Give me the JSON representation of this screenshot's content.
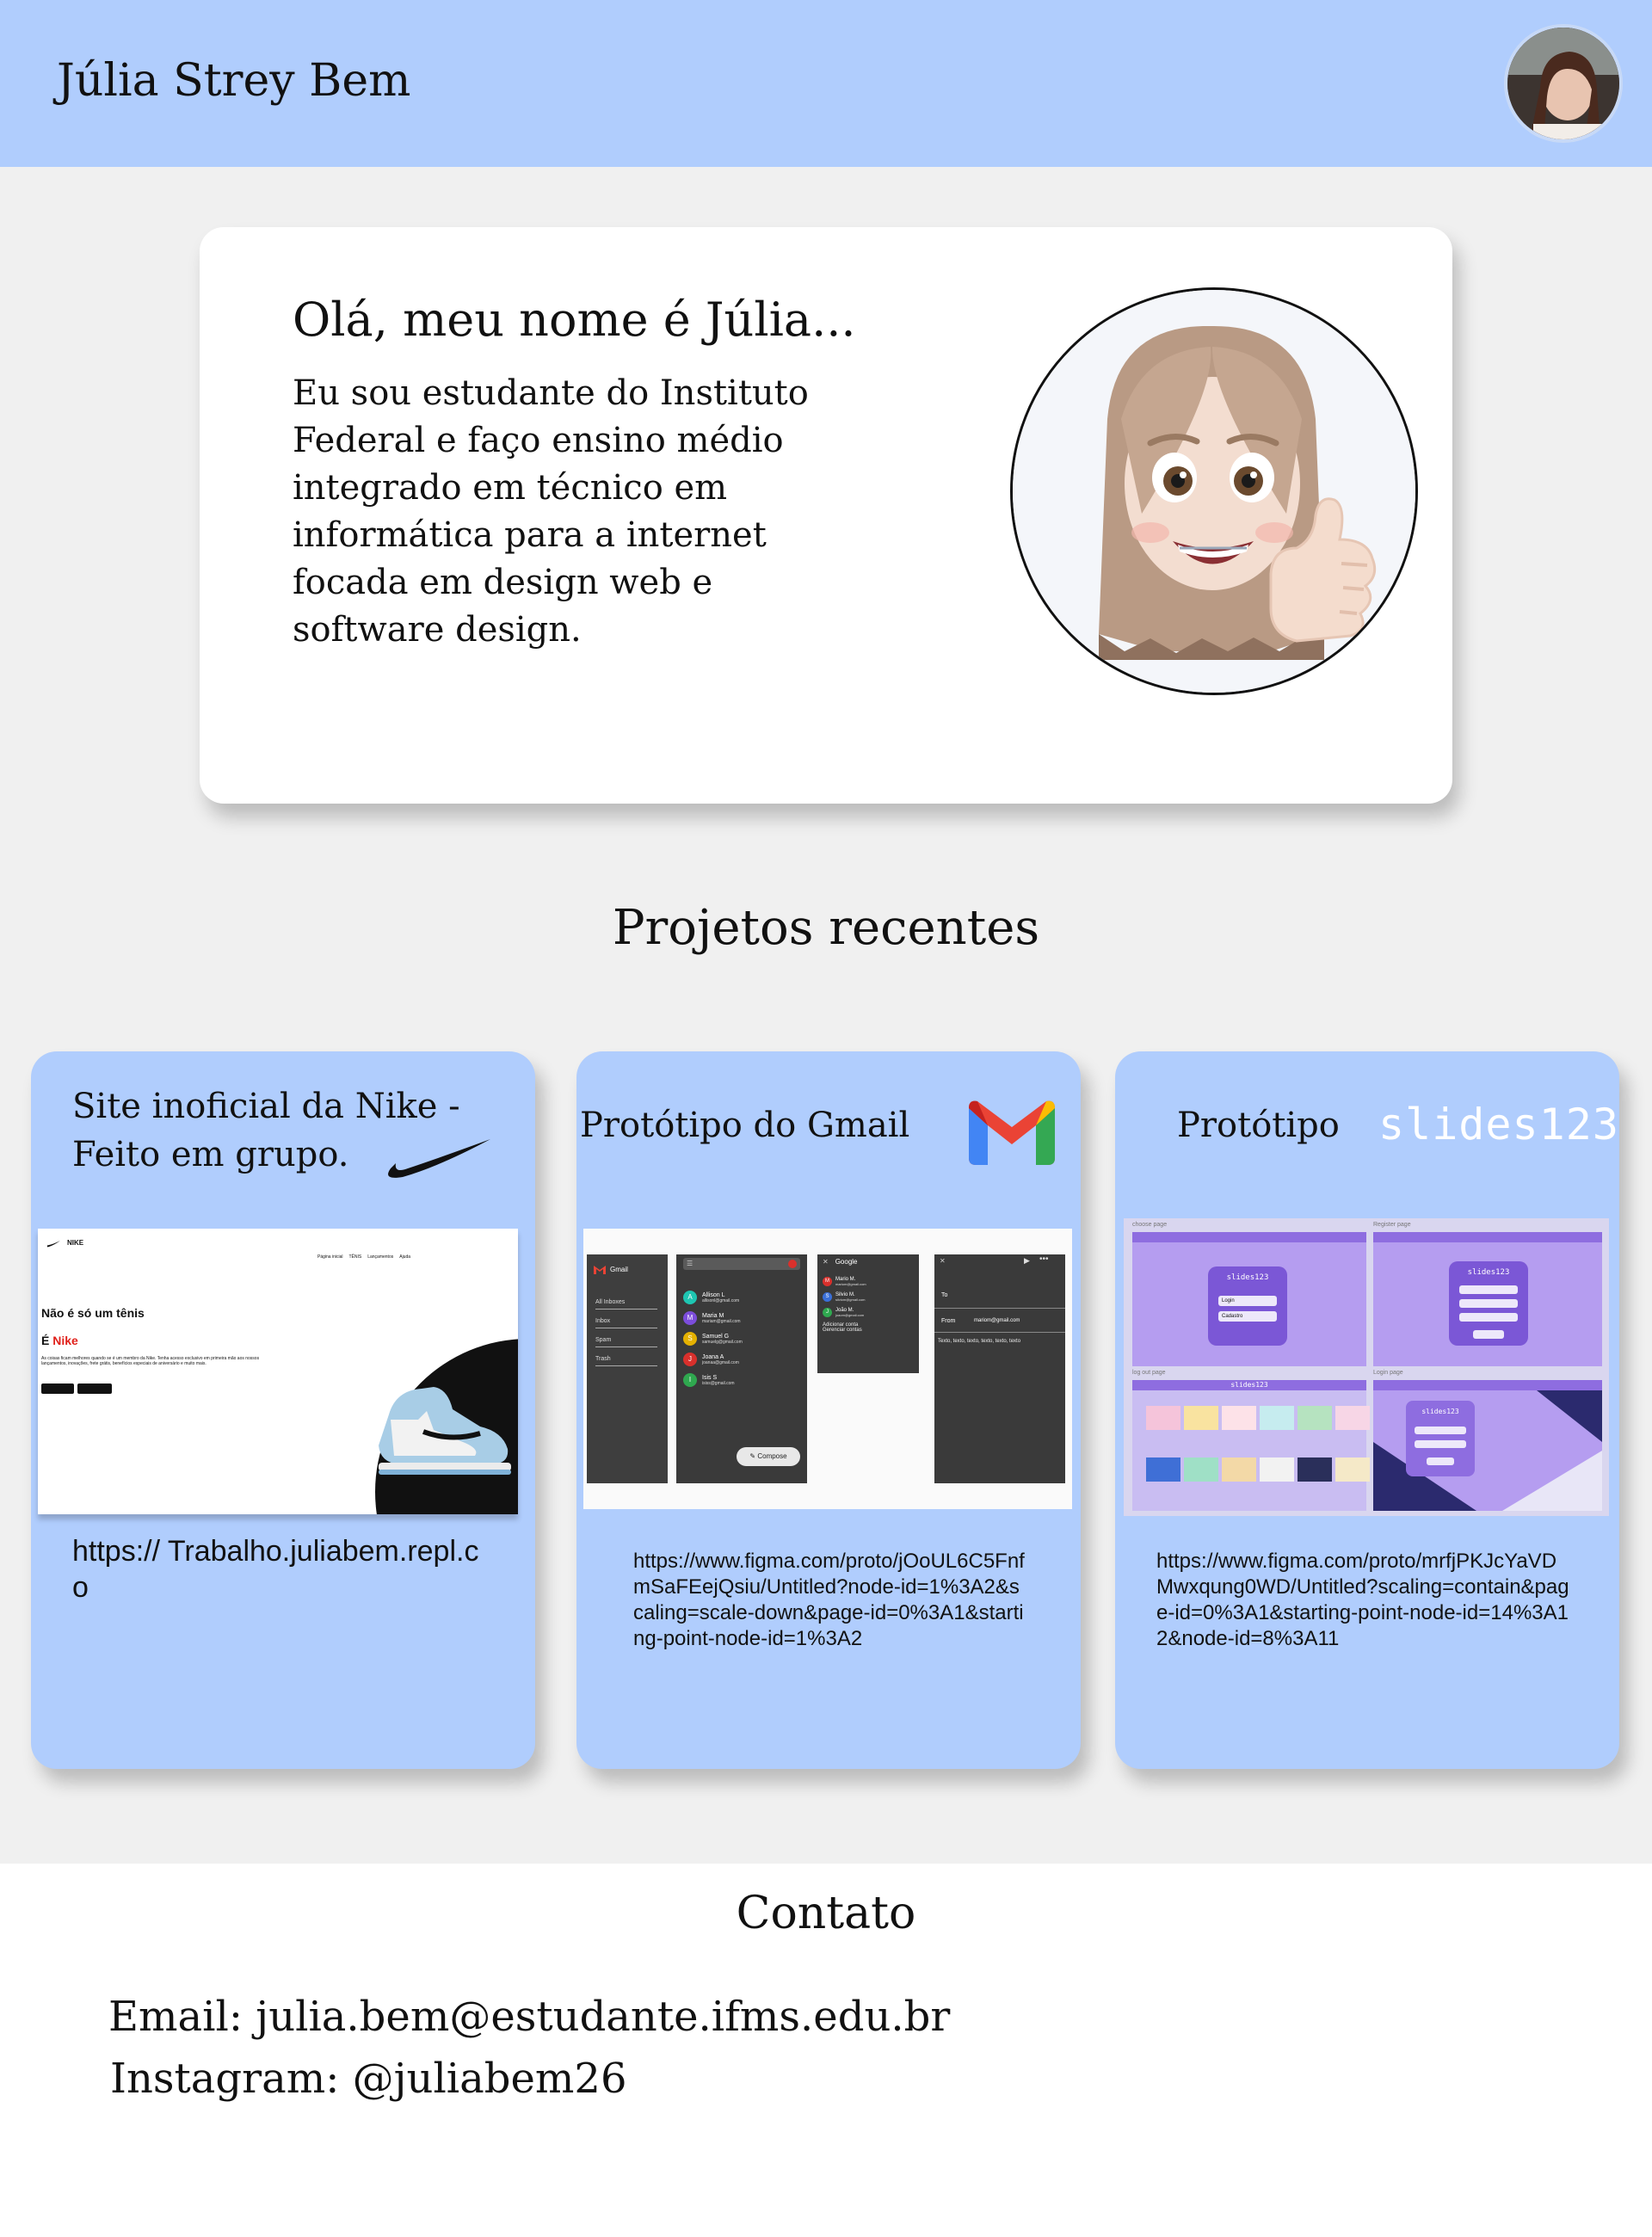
{
  "header": {
    "name": "Júlia Strey Bem"
  },
  "hero": {
    "title": "Olá, meu nome é Júlia...",
    "text": "Eu sou estudante do Instituto Federal e faço ensino médio integrado em técnico em informática para a internet focada em design web e software design."
  },
  "projects": {
    "title": "Projetos recentes",
    "items": [
      {
        "title": "Site inoficial da Nike - Feito em grupo.",
        "link": "https:// Trabalho.juliabem.repl.co"
      },
      {
        "title": "Protótipo do Gmail",
        "link": "https://www.figma.com/proto/jOoUL6C5FnfmSaFEejQsiu/Untitled?node-id=1%3A2&scaling=scale-down&page-id=0%3A1&starting-point-node-id=1%3A2"
      },
      {
        "title": "Protótipo",
        "logo_text": "slides123",
        "link": "https://www.figma.com/proto/mrfjPKJcYaVDMwxqung0WD/Untitled?scaling=contain&page-id=0%3A1&starting-point-node-id=14%3A12&node-id=8%3A11"
      }
    ]
  },
  "nike_shot": {
    "brand": "NIKE",
    "nav": [
      "Página inicial",
      "TÊNIS",
      "Lançamentos",
      "Ajuda"
    ],
    "headline": "Não é só um tênis",
    "subhead_prefix": "É ",
    "subhead_brand": "Nike",
    "body": "As coisas ficam melhores quando se é um membro da Nike. Tenha acesso exclusivo em primeira mão aos nossos lançamentos, inovações, frete grátis, benefícios especiais de aniversário e muito mais."
  },
  "gmail_shot": {
    "app": "Gmail",
    "menu": [
      "All Inboxes",
      "Inbox",
      "Spam",
      "Trash"
    ],
    "contacts": [
      {
        "name": "Allison L",
        "email": "allisonl@gmail.com",
        "initial": "A",
        "color": "#1ec6b2"
      },
      {
        "name": "Maria M",
        "email": "mariam@gmail.com",
        "initial": "M",
        "color": "#7c4ddb"
      },
      {
        "name": "Samuel G",
        "email": "samuelg@gmail.com",
        "initial": "S",
        "color": "#e5b100"
      },
      {
        "name": "Joana A",
        "email": "joanaa@gmail.com",
        "initial": "J",
        "color": "#d9302c"
      },
      {
        "name": "Isis S",
        "email": "isiss@gmail.com",
        "initial": "I",
        "color": "#2fa84f"
      }
    ],
    "compose": "Compose",
    "account_title": "Google",
    "accounts": [
      {
        "name": "Mario M.",
        "email": "mariom@gmail.com",
        "initial": "M",
        "color": "#d9302c"
      },
      {
        "name": "Silvio M.",
        "email": "silviom@gmail.com",
        "initial": "S",
        "color": "#3a6fd8"
      },
      {
        "name": "João M.",
        "email": "joaom@gmail.com",
        "initial": "J",
        "color": "#2fa84f"
      }
    ],
    "add_account": "Adicionar conta",
    "manage_accounts": "Gerenciar contas",
    "to_label": "To",
    "from_label": "From",
    "from_value": "mariom@gmail.com",
    "body": "Texto, texto, texto, texto, texto, texto"
  },
  "slides_shot": {
    "labels": [
      "choose page",
      "Register page",
      "log out page",
      "Login page"
    ],
    "brand": "slides123",
    "login": "Login",
    "register": "Cadastro"
  },
  "contact": {
    "title": "Contato",
    "email": "Email: julia.bem@estudante.ifms.edu.br",
    "instagram": "Instagram: @juliabem26"
  }
}
